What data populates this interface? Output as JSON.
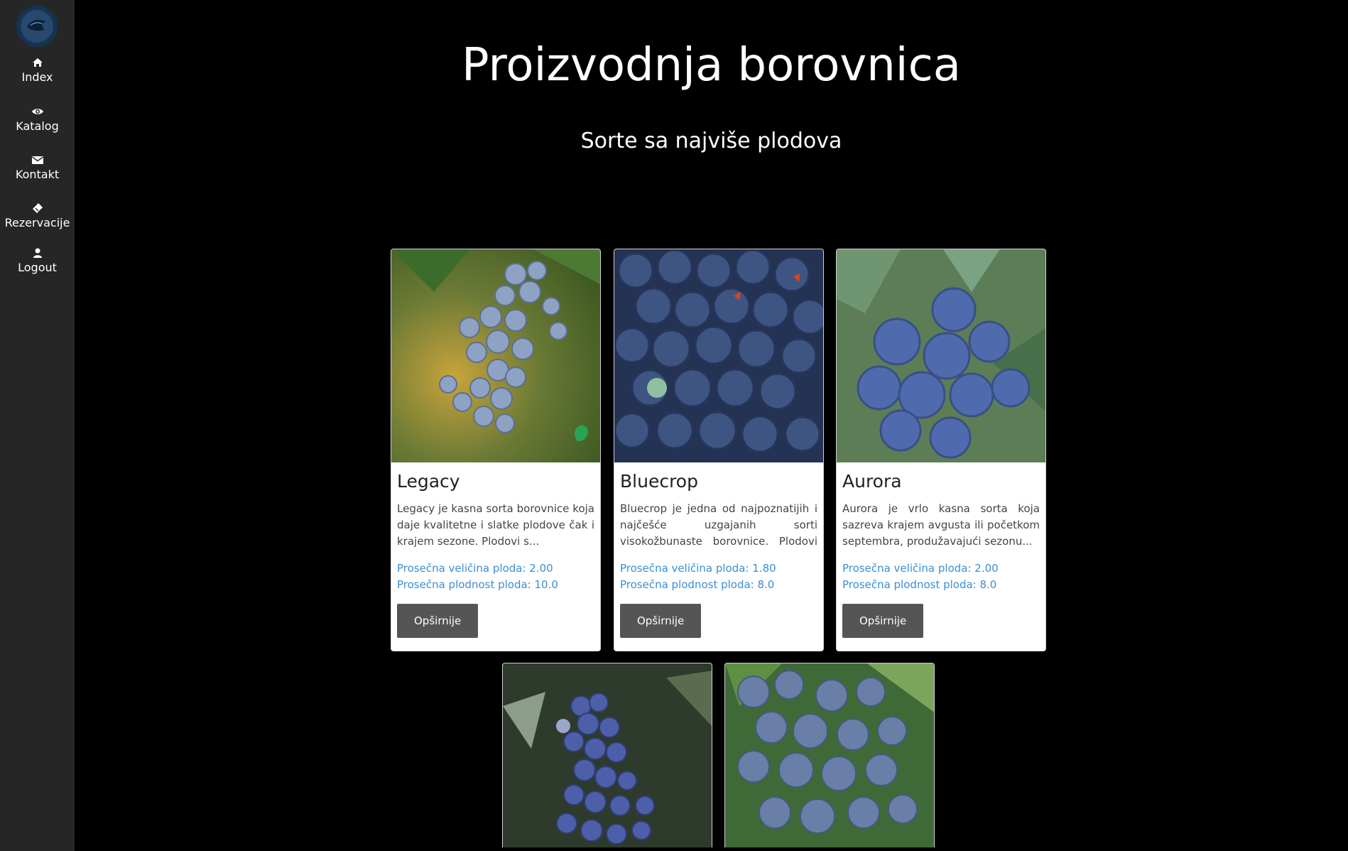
{
  "sidebar": {
    "logo": "blueberry-logo",
    "items": [
      {
        "label": "Index",
        "icon": "home-icon"
      },
      {
        "label": "Katalog",
        "icon": "eye-icon"
      },
      {
        "label": "Kontakt",
        "icon": "envelope-icon"
      },
      {
        "label": "Rezervacije",
        "icon": "ticket-icon"
      },
      {
        "label": "Logout",
        "icon": "user-icon"
      }
    ]
  },
  "header": {
    "title": "Proizvodnja borovnica",
    "subtitle": "Sorte sa najviše plodova"
  },
  "cards": [
    {
      "name": "Legacy",
      "description": "Legacy je kasna sorta borovnice koja daje kvalitetne i slatke plodove čak i krajem sezone. Plodovi s...",
      "size_stat": "Prosečna veličina ploda: 2.00",
      "yield_stat": "Prosečna plodnost ploda: 10.0",
      "button": "Opširnije"
    },
    {
      "name": "Bluecrop",
      "description": "Bluecrop je jedna od najpoznatijih i najčešće uzgajanih sorti visokožbunaste borovnice. Plodovi s...",
      "size_stat": "Prosečna veličina ploda: 1.80",
      "yield_stat": "Prosečna plodnost ploda: 8.0",
      "button": "Opširnije"
    },
    {
      "name": "Aurora",
      "description": "Aurora je vrlo kasna sorta koja sazreva krajem avgusta ili početkom septembra, produžavajući sezonu...",
      "size_stat": "Prosečna veličina ploda: 2.00",
      "yield_stat": "Prosečna plodnost ploda: 8.0",
      "button": "Opširnije"
    }
  ],
  "colors": {
    "sidebar_bg": "#262626",
    "page_bg": "#000000",
    "stat_text": "#3b8ed3",
    "button_bg": "#555555"
  }
}
